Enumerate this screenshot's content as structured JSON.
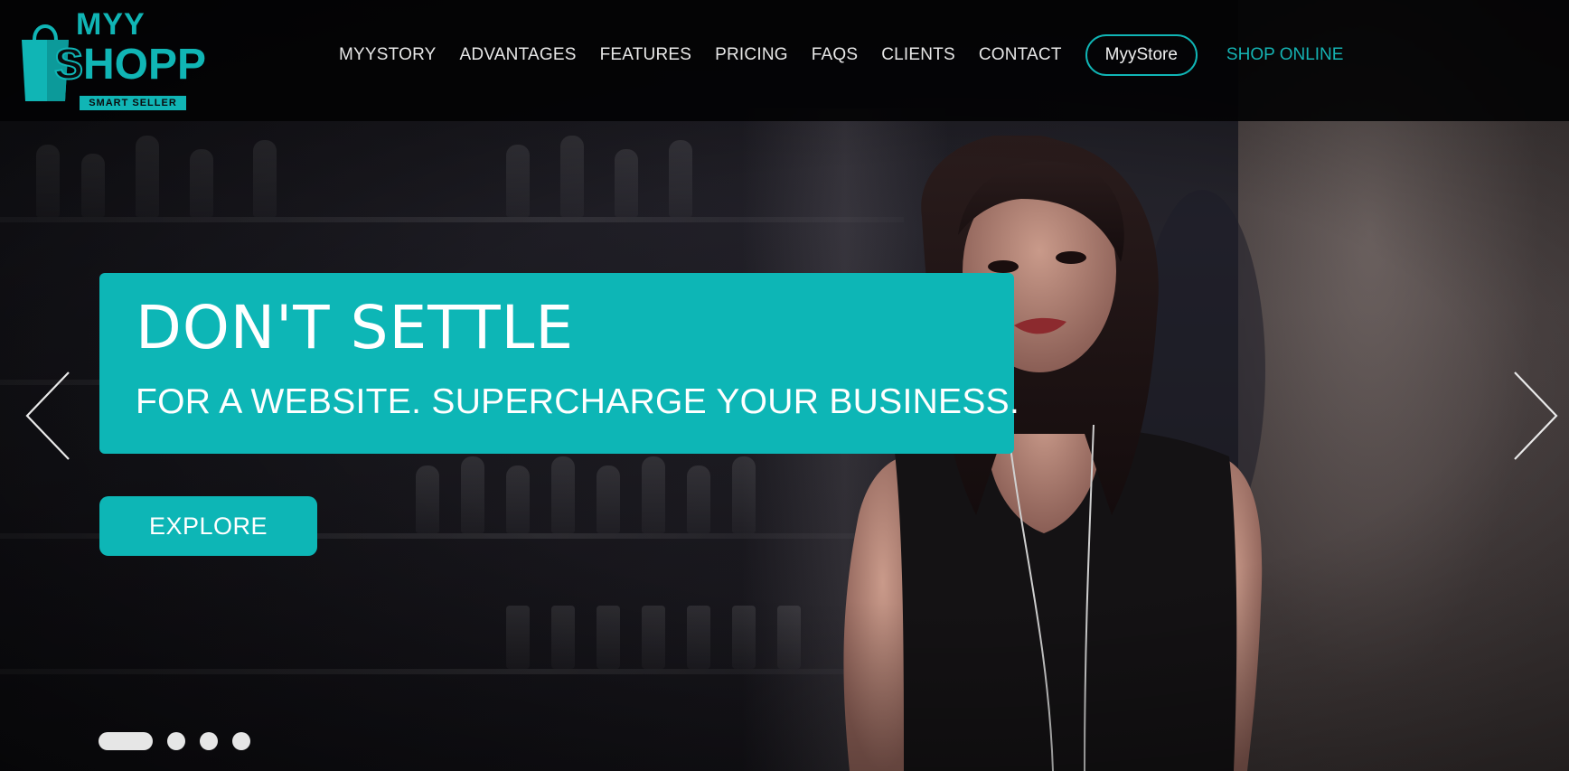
{
  "brand": {
    "line1": "MYY",
    "line2_s": "S",
    "line2_rest": "HOPP",
    "tagline": "SMART SELLER",
    "accent_color": "#10b5b5"
  },
  "nav": {
    "items": [
      {
        "label": "MYYSTORY"
      },
      {
        "label": "ADVANTAGES"
      },
      {
        "label": "FEATURES"
      },
      {
        "label": "PRICING"
      },
      {
        "label": "FAQS"
      },
      {
        "label": "CLIENTS"
      },
      {
        "label": "CONTACT"
      }
    ],
    "store_button": "MyyStore",
    "shop_online": "SHOP ONLINE"
  },
  "hero": {
    "headline": "DON'T SETTLE",
    "subheadline": "FOR A WEBSITE. SUPERCHARGE YOUR BUSINESS.",
    "cta": "EXPLORE",
    "prev_icon": "chevron-left-icon",
    "next_icon": "chevron-right-icon",
    "slides_total": 4,
    "active_slide": 1
  }
}
